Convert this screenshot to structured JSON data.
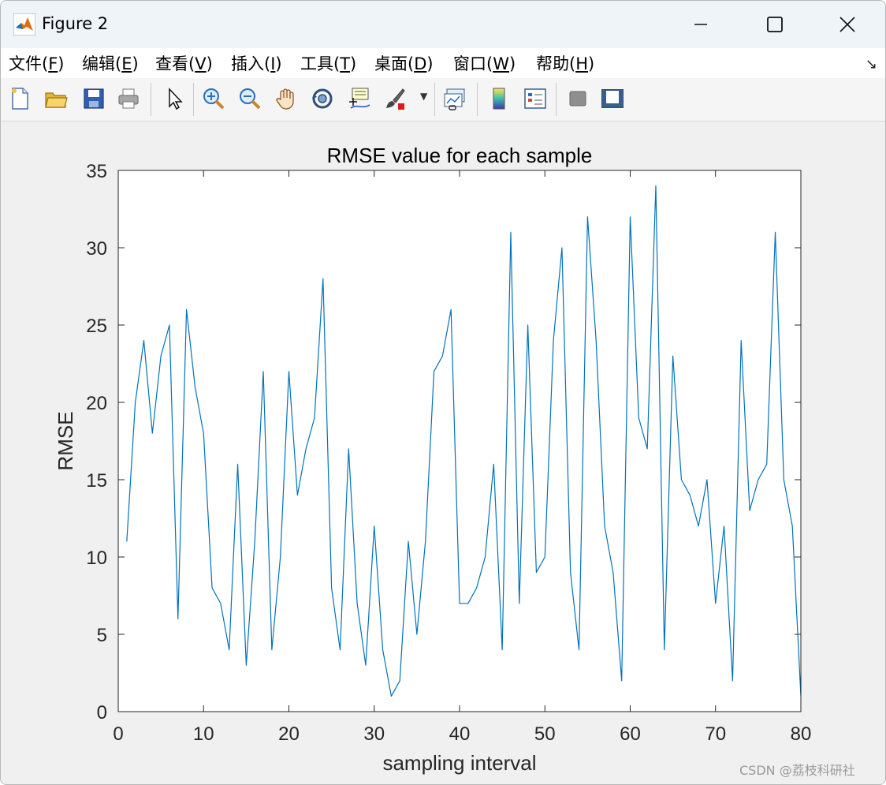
{
  "window": {
    "title": "Figure 2"
  },
  "menu": {
    "items": [
      {
        "label": "文件(",
        "key": "F",
        "end": ")"
      },
      {
        "label": "编辑(",
        "key": "E",
        "end": ")"
      },
      {
        "label": "查看(",
        "key": "V",
        "end": ")"
      },
      {
        "label": "插入(",
        "key": "I",
        "end": ")"
      },
      {
        "label": "工具(",
        "key": "T",
        "end": ")"
      },
      {
        "label": "桌面(",
        "key": "D",
        "end": ")"
      },
      {
        "label": "窗口(",
        "key": "W",
        "end": ")"
      },
      {
        "label": "帮助(",
        "key": "H",
        "end": ")"
      }
    ]
  },
  "toolbar": {
    "icons": [
      "new-figure-icon",
      "open-file-icon",
      "save-icon",
      "print-icon",
      "edit-pointer-icon",
      "zoom-in-icon",
      "zoom-out-icon",
      "pan-hand-icon",
      "rotate-3d-icon",
      "data-cursor-icon",
      "brush-icon",
      "link-plot-icon",
      "colorbar-icon",
      "legend-icon",
      "hide-plot-tools-icon",
      "show-plot-tools-icon"
    ]
  },
  "colors": {
    "line": "#0072bd",
    "axis_bg": "#ffffff",
    "figure_bg": "#f0f0f0"
  },
  "watermark": "CSDN @荔枝科研社",
  "chart_data": {
    "type": "line",
    "title": "RMSE value for each sample",
    "xlabel": "sampling interval",
    "ylabel": "RMSE",
    "xlim": [
      0,
      80
    ],
    "ylim": [
      0,
      35
    ],
    "xticks": [
      0,
      10,
      20,
      30,
      40,
      50,
      60,
      70,
      80
    ],
    "yticks": [
      0,
      5,
      10,
      15,
      20,
      25,
      30,
      35
    ],
    "grid": false,
    "x": [
      1,
      2,
      3,
      4,
      5,
      6,
      7,
      8,
      9,
      10,
      11,
      12,
      13,
      14,
      15,
      16,
      17,
      18,
      19,
      20,
      21,
      22,
      23,
      24,
      25,
      26,
      27,
      28,
      29,
      30,
      31,
      32,
      33,
      34,
      35,
      36,
      37,
      38,
      39,
      40,
      41,
      42,
      43,
      44,
      45,
      46,
      47,
      48,
      49,
      50,
      51,
      52,
      53,
      54,
      55,
      56,
      57,
      58,
      59,
      60,
      61,
      62,
      63,
      64,
      65,
      66,
      67,
      68,
      69,
      70,
      71,
      72,
      73,
      74,
      75,
      76,
      77,
      78,
      79,
      80
    ],
    "series": [
      {
        "values": [
          11,
          20,
          24,
          18,
          23,
          25,
          6,
          26,
          21,
          18,
          8,
          7,
          4,
          16,
          3,
          11,
          22,
          4,
          10,
          22,
          14,
          17,
          19,
          28,
          8,
          4,
          17,
          7,
          3,
          12,
          4,
          1,
          2,
          11,
          5,
          11,
          22,
          23,
          26,
          7,
          7,
          8,
          10,
          16,
          4,
          31,
          7,
          25,
          9,
          10,
          24,
          30,
          9,
          4,
          32,
          24,
          12,
          9,
          2,
          32,
          19,
          17,
          34,
          4,
          23,
          15,
          14,
          12,
          15,
          7,
          12,
          2,
          24,
          13,
          15,
          16,
          31,
          15,
          12,
          1
        ]
      }
    ]
  }
}
